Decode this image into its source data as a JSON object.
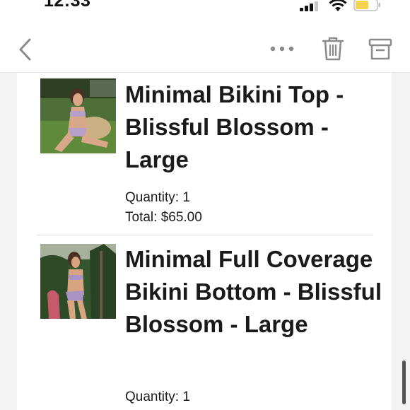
{
  "status_bar": {
    "time": "12:33"
  },
  "toolbar": {
    "back_icon": "chevron-left-icon",
    "more_icon": "more-horizontal-icon",
    "trash_icon": "trash-icon",
    "archive_icon": "archive-icon"
  },
  "items": [
    {
      "title": "Minimal Bikini Top - Blissful Blossom - Large",
      "quantity": "Quantity: 1",
      "total": "Total: $65.00"
    },
    {
      "title": "Minimal Full Coverage Bikini Bottom - Blissful Blossom - Large",
      "quantity": "Quantity: 1"
    }
  ],
  "colors": {
    "background": "#f3f3f3",
    "card": "#ffffff",
    "text": "#1a1a1a",
    "icon": "#8a8a8a",
    "battery": "#f7d54a"
  }
}
